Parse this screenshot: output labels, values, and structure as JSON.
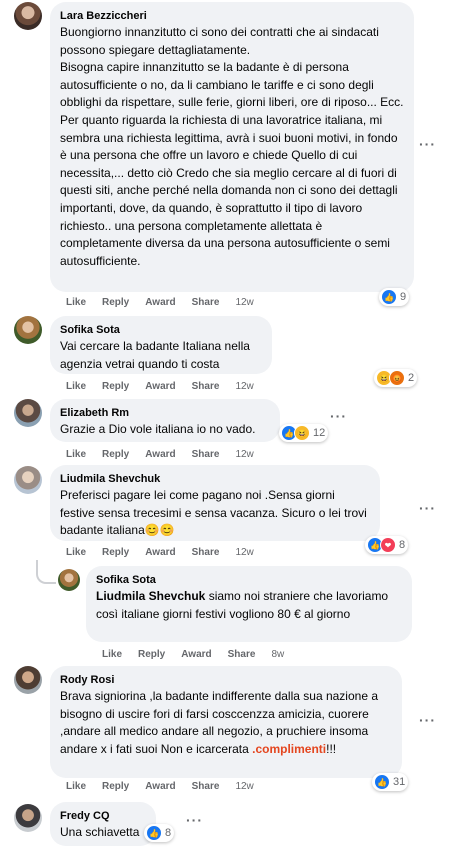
{
  "actions": {
    "like": "Like",
    "reply": "Reply",
    "award": "Award",
    "share": "Share"
  },
  "comments": [
    {
      "author": "Lara Bezziccheri",
      "text": "Buongiorno innanzitutto ci sono dei contratti che ai sindacati possono spiegare dettagliatamente.\nBisogna capire innanzitutto se la badante è di persona autosufficiente o no, da li cambiano le tariffe e ci sono degli obblighi da rispettare, sulle ferie, giorni liberi, ore di riposo... Ecc. Per quanto riguarda la richiesta di una lavoratrice italiana, mi sembra una richiesta legittima, avrà i suoi buoni motivi, in fondo è una persona che offre un lavoro e chiede Quello di cui necessita,... detto ciò Credo che sia meglio cercare al di fuori di questi siti, anche perché nella domanda non ci sono dei dettagli importanti, dove, da quando, è soprattutto il tipo di lavoro richiesto.. una persona completamente allettata è completamente diversa da una persona autosufficiente o semi autosufficiente.",
      "time": "12w",
      "reaction_count": "9"
    },
    {
      "author": "Sofika Sota",
      "text": "Vai cercare la badante Italiana nella agenzia vetrai quando ti costa",
      "time": "12w",
      "reaction_count": "2"
    },
    {
      "author": "Elizabeth Rm",
      "text": "Grazie a Dio vole italiana io no vado.",
      "time": "12w",
      "reaction_count": "12"
    },
    {
      "author": "Liudmila Shevchuk",
      "text": "Preferisci pagare lei come pagano noi .Sensa giorni festive sensa trecesimi e sensa vacanza. Sicuro o lei trovi badante italiana😊😊",
      "time": "12w",
      "reaction_count": "8"
    },
    {
      "author": "Sofika Sota",
      "mention": "Liudmila Shevchuk",
      "text": " siamo noi straniere che lavoriamo così italiane giorni festivi vogliono 80 € al giorno",
      "time": "8w"
    },
    {
      "author": "Rody Rosi",
      "text": "Brava signiorina ,la badante indifferente dalla sua nazione a bisogno di uscire fori di farsi cosccenzza amicizia, cuorere ,andare all medico andare all negozio, a pruchiere insoma andare x i fati suoi Non e icarcerata ",
      "highlight": ".complimenti",
      "text_end": "!!!",
      "time": "12w",
      "reaction_count": "31"
    },
    {
      "author": "Fredy CQ",
      "text": "Una schiavetta",
      "reaction_count": "8"
    }
  ]
}
